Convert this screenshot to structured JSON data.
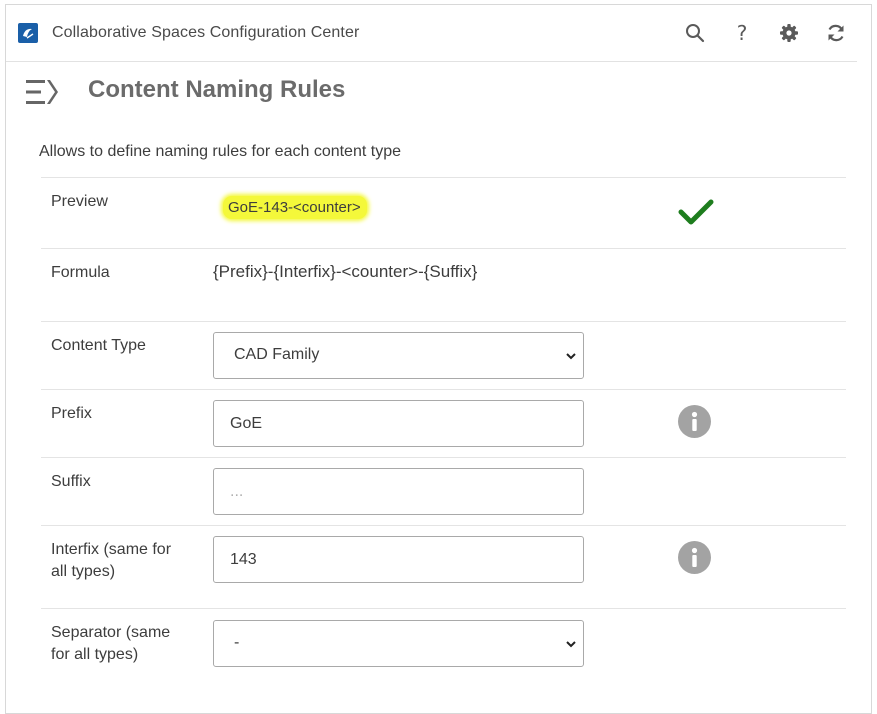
{
  "app": {
    "title": "Collaborative Spaces Configuration Center",
    "logo_icon": "3ds-logo-icon",
    "toolbar_icons": [
      "search-icon",
      "help-icon",
      "gear-icon",
      "refresh-icon"
    ],
    "help_glyph": "?"
  },
  "header": {
    "menu_icon": "menu-toggle-icon",
    "title": "Content Naming Rules",
    "description": "Allows to define naming rules for each content type"
  },
  "colors": {
    "highlight": "#f4f83a",
    "success": "#1e7d1e",
    "info": "#a3a3a3",
    "logo": "#1a5fa8"
  },
  "rows": {
    "preview": {
      "label": "Preview",
      "value": "GoE-143-<counter>",
      "status_icon": "checkmark-icon"
    },
    "formula": {
      "label": "Formula",
      "value": "{Prefix}-{Interfix}-<counter>-{Suffix}"
    },
    "content_type": {
      "label": "Content Type",
      "selected": "CAD Family"
    },
    "prefix": {
      "label": "Prefix",
      "value": "GoE",
      "info_icon": "info-icon"
    },
    "suffix": {
      "label": "Suffix",
      "value": "",
      "placeholder": "..."
    },
    "interfix": {
      "label": "Interfix (same for all types)",
      "value": "143",
      "info_icon": "info-icon"
    },
    "separator": {
      "label": "Separator (same for all types)",
      "selected": "-"
    }
  }
}
